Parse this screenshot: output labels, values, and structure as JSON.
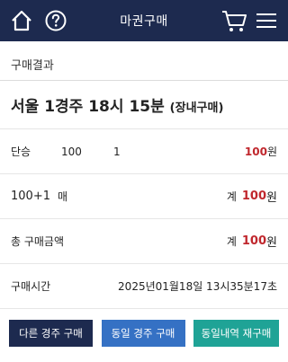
{
  "header": {
    "title": "마권구매"
  },
  "section_title": "구매결과",
  "race": {
    "main": "서울 1경주 18시 15분",
    "sub": "(장내구매)"
  },
  "bet": {
    "type": "단승",
    "number": "100",
    "count": "1",
    "amount": "100",
    "currency": "원"
  },
  "unit_row": {
    "label": "100+1",
    "unit": "매",
    "total_label": "계",
    "amount": "100",
    "currency": "원"
  },
  "total_row": {
    "label": "총 구매금액",
    "total_label": "계",
    "amount": "100",
    "currency": "원"
  },
  "time_row": {
    "label": "구매시간",
    "value": "2025년01월18일 13시35분17초"
  },
  "buttons": {
    "other_race": "다른 경주 구매",
    "same_race": "동일 경주 구매",
    "repurchase": "동일내역 재구매"
  },
  "colors": {
    "header_bg": "#1d2a4f",
    "accent_red": "#c0272d",
    "btn_navy": "#1d2a4f",
    "btn_blue": "#3571c4",
    "btn_teal": "#1fa396"
  },
  "icons": [
    "home-icon",
    "help-icon",
    "cart-icon",
    "menu-icon"
  ]
}
